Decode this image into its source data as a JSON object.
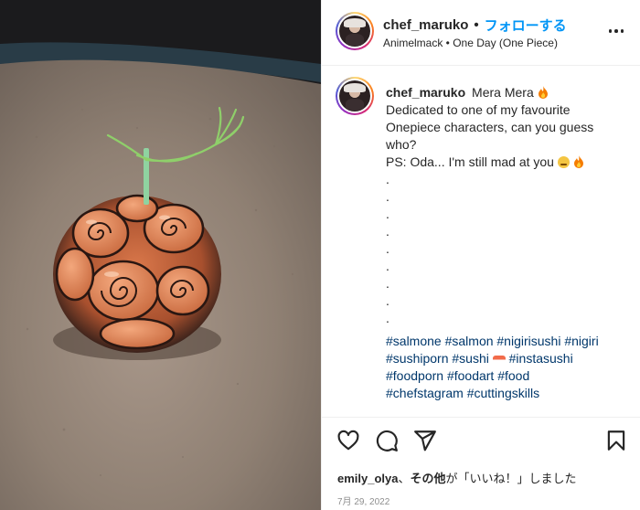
{
  "post": {
    "username": "chef_maruko",
    "separator": "•",
    "follow_label": "フォローする",
    "subtitle": "Animelmack • One Day (One Piece)"
  },
  "caption": {
    "username": "chef_maruko",
    "line1": "Mera Mera",
    "line2": "Dedicated to one of my favourite",
    "line3": "Onepiece characters, can you guess",
    "line4": "who?",
    "line5": "PS: Oda... I'm still mad at you",
    "dots": [
      ".",
      ".",
      ".",
      ".",
      ".",
      ".",
      ".",
      ".",
      "."
    ],
    "tags_line1": "#salmone #salmon #nigirisushi #nigiri",
    "tags_line2a": "#sushiporn #sushi",
    "tags_line2b": " #instasushi",
    "tags_line3": "#foodporn #foodart #food",
    "tags_line4": "#chefstagram #cuttingskills"
  },
  "engagement": {
    "liker": "emily_olya",
    "liker_sep": "、",
    "others": "その他",
    "likes_text": "が「いいね！」しました",
    "date": "7月 29, 2022"
  },
  "icons": {
    "more": "more-options-icon",
    "like": "heart-icon",
    "comment": "comment-icon",
    "share": "share-icon",
    "save": "bookmark-icon",
    "flame": "fire-emoji-icon",
    "face": "angry-face-emoji-icon",
    "sushi": "sushi-emoji-icon"
  },
  "colors": {
    "follow": "#0095f6",
    "hashtag": "#00376b",
    "date": "#8e8e8e",
    "text": "#262626"
  }
}
